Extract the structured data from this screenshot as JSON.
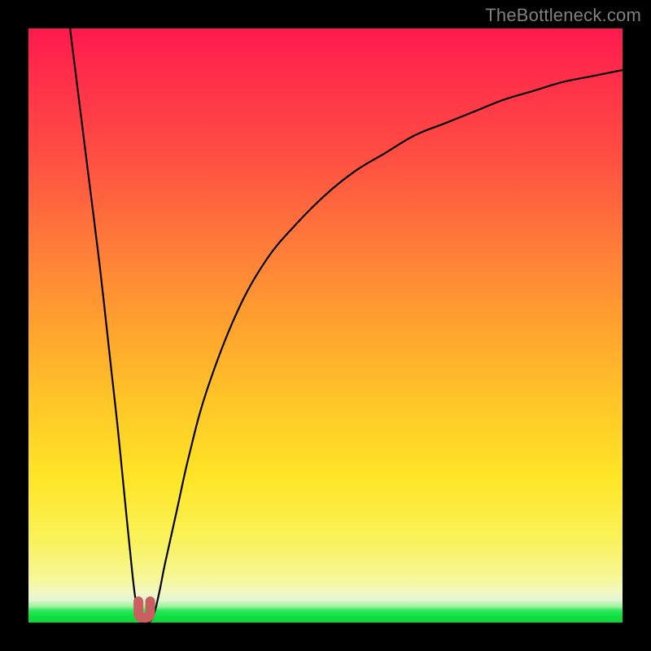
{
  "watermark": {
    "text": "TheBottleneck.com"
  },
  "chart_data": {
    "type": "line",
    "title": "",
    "xlabel": "",
    "ylabel": "",
    "xlim": [
      0,
      100
    ],
    "ylim": [
      0,
      100
    ],
    "grid": false,
    "legend": false,
    "notes": "No axis ticks/labels visible. y=0 corresponds to best match (green band at bottom); higher y = worse (red at top). Background is a vertical red→green gradient.",
    "series": [
      {
        "name": "bottleneck-curve",
        "color": "#000000",
        "x": [
          7,
          8,
          10,
          12,
          14,
          15,
          16,
          17,
          18,
          19,
          20,
          21,
          22,
          23,
          25,
          27,
          30,
          35,
          40,
          45,
          50,
          55,
          60,
          65,
          70,
          75,
          80,
          85,
          90,
          95,
          100
        ],
        "y": [
          100,
          92,
          76,
          60,
          42,
          33,
          23,
          13,
          4,
          0,
          0,
          1,
          5,
          10,
          19,
          28,
          39,
          52,
          61,
          67,
          72,
          76,
          79,
          82,
          84,
          86,
          88,
          89.5,
          91,
          92,
          93
        ]
      },
      {
        "name": "optimal-marker",
        "type": "marker",
        "color": "#c95f60",
        "shape": "u-bracket",
        "x": [
          18.5,
          20.5
        ],
        "y": [
          2,
          2
        ]
      }
    ],
    "gradient_scale": {
      "axis": "y",
      "description": "color encodes y-value from best (green, bottom) to worst (red, top)",
      "stops": [
        {
          "y": 0,
          "color": "#0cd63a"
        },
        {
          "y": 3,
          "color": "#2be85b"
        },
        {
          "y": 6,
          "color": "#e3f7d1"
        },
        {
          "y": 12,
          "color": "#f6f797"
        },
        {
          "y": 24,
          "color": "#ffe627"
        },
        {
          "y": 40,
          "color": "#ffc927"
        },
        {
          "y": 55,
          "color": "#ffa22e"
        },
        {
          "y": 70,
          "color": "#ff7a3a"
        },
        {
          "y": 85,
          "color": "#ff5042"
        },
        {
          "y": 100,
          "color": "#ff1a4d"
        }
      ]
    }
  }
}
